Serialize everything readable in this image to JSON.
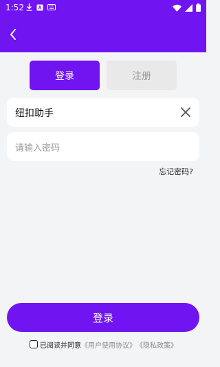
{
  "status_bar": {
    "time": "1:52"
  },
  "tabs": {
    "login": "登录",
    "register": "注册"
  },
  "form": {
    "username_value": "纽扣助手",
    "password_placeholder": "请输入密码",
    "forgot_password": "忘记密码?"
  },
  "login_button": "登录",
  "agreement": {
    "text": "已阅读并同意",
    "user_agreement": "《用户使用协议》",
    "privacy_policy": "《隐私政策》"
  },
  "colors": {
    "accent": "#7014f2",
    "background": "#f3f4f6",
    "tab_inactive": "#e9e9ea"
  }
}
